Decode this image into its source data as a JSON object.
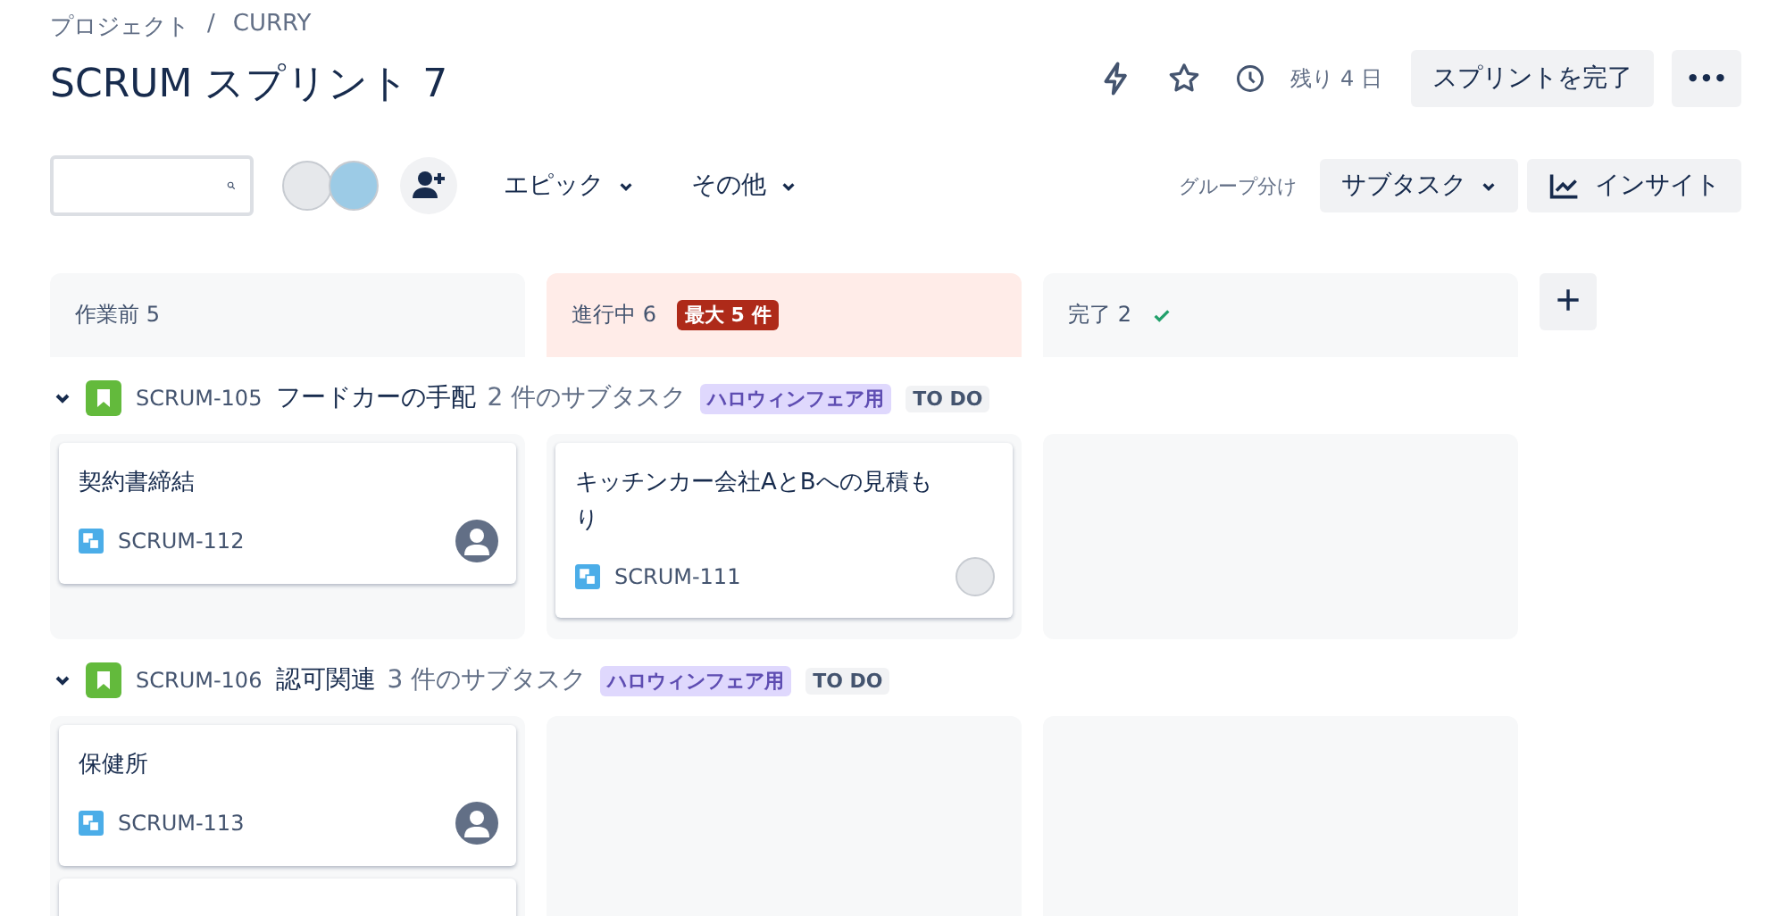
{
  "breadcrumb": {
    "items": [
      "プロジェクト",
      "CURRY"
    ],
    "separator": "/"
  },
  "title": "SCRUM スプリント 7",
  "header_actions": {
    "remaining": "残り 4 日",
    "complete_button": "スプリントを完了",
    "more_button": "•••"
  },
  "toolbar": {
    "filters": [
      "エピック",
      "その他"
    ],
    "group_by_label": "グループ分け",
    "group_by_value": "サブタスク",
    "insight_button": "インサイト"
  },
  "columns": [
    {
      "name": "作業前 5",
      "kind": "plain"
    },
    {
      "name": "進行中 6",
      "kind": "limited",
      "limit_badge": "最大 5 件"
    },
    {
      "name": "完了 2",
      "kind": "done"
    }
  ],
  "add_column_button": "+",
  "lanes": [
    {
      "expanded": true,
      "key": "SCRUM-105",
      "title": "フードカーの手配",
      "subtasks": "2 件のサブタスク",
      "epic": "ハロウィンフェア用",
      "status": "TO DO",
      "cells": [
        [
          {
            "title": "契約書締結",
            "key": "SCRUM-112",
            "kind": "unassigned"
          }
        ],
        [
          {
            "title": "キッチンカー会社AとBへの見積もり",
            "key": "SCRUM-111",
            "kind": "assigned"
          }
        ],
        []
      ]
    },
    {
      "expanded": true,
      "key": "SCRUM-106",
      "title": "認可関連",
      "subtasks": "3 件のサブタスク",
      "epic": "ハロウィンフェア用",
      "status": "TO DO",
      "cells": [
        [
          {
            "title": "保健所",
            "key": "SCRUM-113",
            "kind": "unassigned"
          },
          {
            "kind": "cut_off"
          }
        ],
        [],
        []
      ]
    }
  ]
}
